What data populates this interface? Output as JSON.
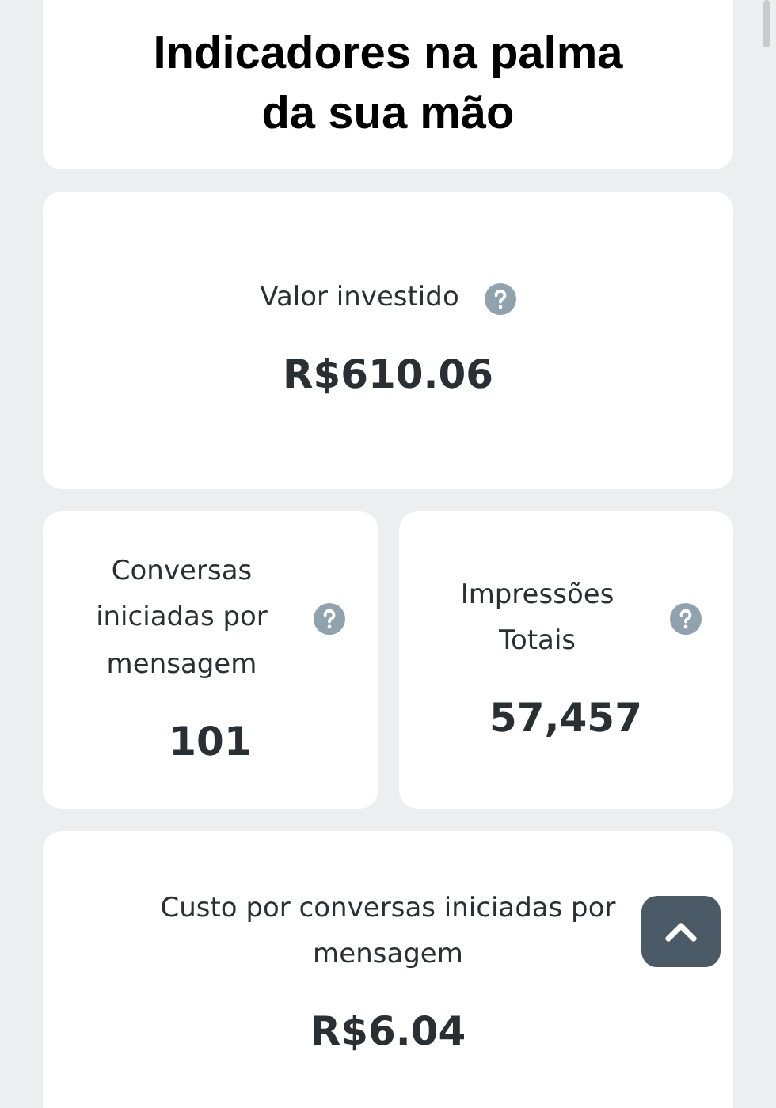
{
  "title": "Indicadores na palma da sua mão",
  "metrics": [
    {
      "kind": "wide",
      "label": "Valor investido",
      "help": true,
      "value": "R$610.06"
    },
    {
      "kind": "half",
      "label": "Conversas iniciadas por mensagem",
      "help": true,
      "value": "101"
    },
    {
      "kind": "half",
      "label": "Impressões Totais",
      "help": true,
      "value": "57,457"
    },
    {
      "kind": "wide",
      "label": "Custo por conversas iniciadas por mensagem",
      "help": false,
      "value": "R$6.04"
    }
  ],
  "scroll_top_button": {
    "visible": true
  }
}
